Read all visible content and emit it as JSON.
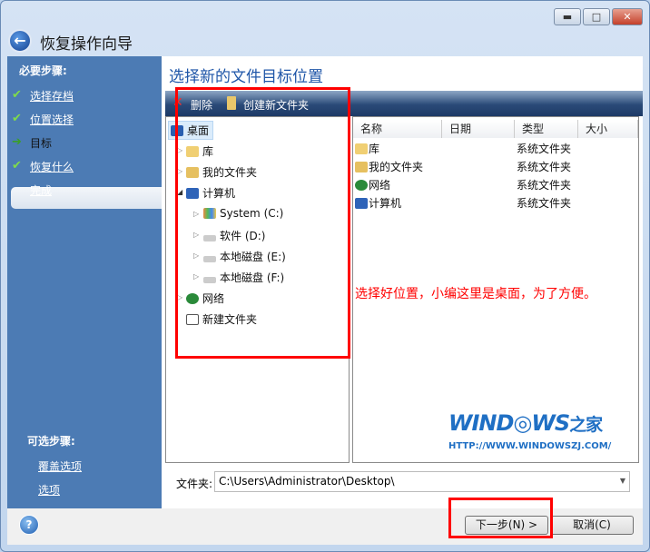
{
  "window": {
    "title": "恢复操作向导",
    "minimize": "▬",
    "maximize": "□",
    "close": "✕"
  },
  "sidebar": {
    "required_label": "必要步骤:",
    "steps": [
      {
        "label": "选择存档",
        "state": "done"
      },
      {
        "label": "位置选择",
        "state": "done"
      },
      {
        "label": "目标",
        "state": "current"
      },
      {
        "label": "恢复什么",
        "state": "done"
      },
      {
        "label": "完成",
        "state": "pending"
      }
    ],
    "optional_label": "可选步骤:",
    "optional": [
      {
        "label": "覆盖选项"
      },
      {
        "label": "选项"
      }
    ]
  },
  "main": {
    "heading": "选择新的文件目标位置",
    "toolbar": {
      "delete": "删除",
      "new_folder": "创建新文件夹"
    },
    "tree": [
      {
        "label": "桌面"
      },
      {
        "label": "库"
      },
      {
        "label": "我的文件夹"
      },
      {
        "label": "计算机"
      },
      {
        "label": "System (C:)"
      },
      {
        "label": "软件 (D:)"
      },
      {
        "label": "本地磁盘 (E:)"
      },
      {
        "label": "本地磁盘 (F:)"
      },
      {
        "label": "网络"
      },
      {
        "label": "新建文件夹"
      }
    ],
    "columns": [
      "名称",
      "日期",
      "类型",
      "大小"
    ],
    "rows": [
      {
        "name": "库",
        "type": "系统文件夹"
      },
      {
        "name": "我的文件夹",
        "type": "系统文件夹"
      },
      {
        "name": "网络",
        "type": "系统文件夹"
      },
      {
        "name": "计算机",
        "type": "系统文件夹"
      }
    ],
    "folder_label": "文件夹:",
    "folder_value": "C:\\Users\\Administrator\\Desktop\\"
  },
  "annotation": "选择好位置，小编这里是桌面，为了方便。",
  "watermark": {
    "logo": "WIND◎WS",
    "logo_cn": "之家",
    "url": "HTTP://WWW.WINDOWSZJ.COM/"
  },
  "buttons": {
    "help": "?",
    "next": "下一步(N) >",
    "cancel": "取消(C)"
  },
  "colors": {
    "sidebar": "#4c7bb4",
    "heading": "#1f56a8",
    "annotation": "#ff0000"
  }
}
